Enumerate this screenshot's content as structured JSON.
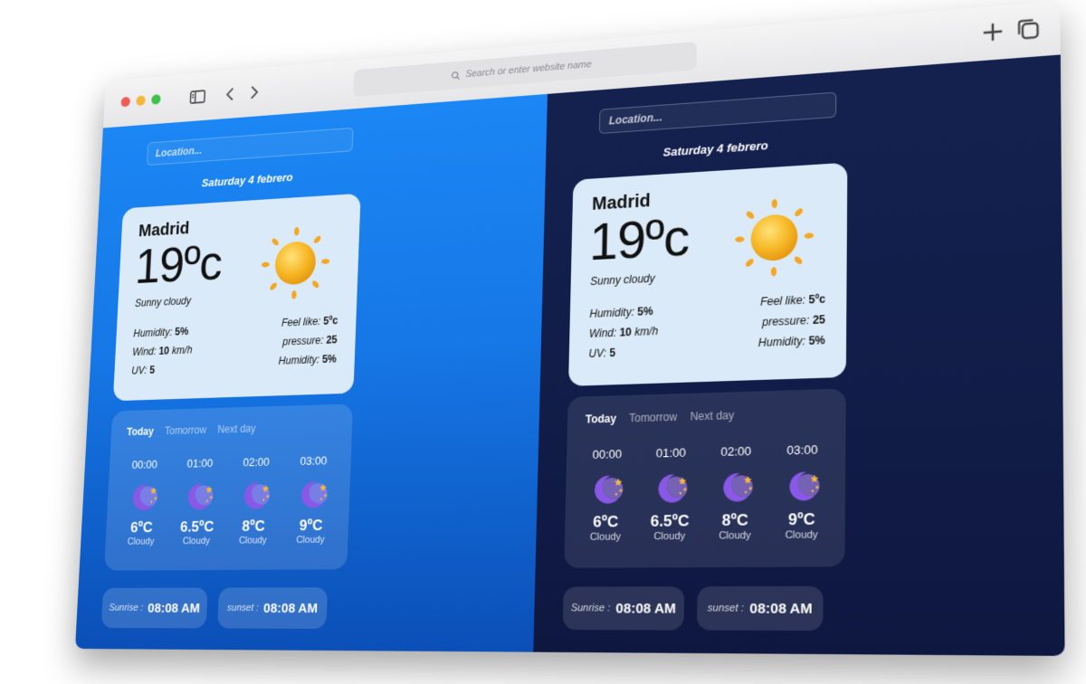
{
  "browser": {
    "address_placeholder": "Search or enter website name"
  },
  "panes": [
    {
      "theme": "light",
      "location_placeholder": "Location...",
      "date": "Saturday 4 febrero",
      "city": "Madrid",
      "temperature": "19ºc",
      "condition": "Sunny cloudy",
      "details_left": [
        {
          "label": "Humidity:",
          "value": "5%"
        },
        {
          "label": "Wind:",
          "value": "10",
          "unit": "km/h"
        },
        {
          "label": "UV:",
          "value": "5"
        }
      ],
      "details_right": [
        {
          "label": "Feel like:",
          "value": "5ºc"
        },
        {
          "label": "pressure:",
          "value": "25"
        },
        {
          "label": "Humidity:",
          "value": "5%"
        }
      ],
      "tabs": [
        "Today",
        "Tomorrow",
        "Next day"
      ],
      "active_tab": "Today",
      "hourly": [
        {
          "time": "00:00",
          "temp": "6ºC",
          "cond": "Cloudy",
          "icon": "moon-stars-icon"
        },
        {
          "time": "01:00",
          "temp": "6.5ºC",
          "cond": "Cloudy",
          "icon": "moon-stars-icon"
        },
        {
          "time": "02:00",
          "temp": "8ºC",
          "cond": "Cloudy",
          "icon": "moon-stars-icon"
        },
        {
          "time": "03:00",
          "temp": "9ºC",
          "cond": "Cloudy",
          "icon": "moon-stars-icon"
        }
      ],
      "sunrise_label": "Sunrise :",
      "sunrise": "08:08 AM",
      "sunset_label": "sunset :",
      "sunset": "08:08 AM"
    },
    {
      "theme": "dark",
      "location_placeholder": "Location...",
      "date": "Saturday 4 febrero",
      "city": "Madrid",
      "temperature": "19ºc",
      "condition": "Sunny cloudy",
      "details_left": [
        {
          "label": "Humidity:",
          "value": "5%"
        },
        {
          "label": "Wind:",
          "value": "10",
          "unit": "km/h"
        },
        {
          "label": "UV:",
          "value": "5"
        }
      ],
      "details_right": [
        {
          "label": "Feel like:",
          "value": "5ºc"
        },
        {
          "label": "pressure:",
          "value": "25"
        },
        {
          "label": "Humidity:",
          "value": "5%"
        }
      ],
      "tabs": [
        "Today",
        "Tomorrow",
        "Next day"
      ],
      "active_tab": "Today",
      "hourly": [
        {
          "time": "00:00",
          "temp": "6ºC",
          "cond": "Cloudy",
          "icon": "moon-stars-icon"
        },
        {
          "time": "01:00",
          "temp": "6.5ºC",
          "cond": "Cloudy",
          "icon": "moon-stars-icon"
        },
        {
          "time": "02:00",
          "temp": "8ºC",
          "cond": "Cloudy",
          "icon": "moon-stars-icon"
        },
        {
          "time": "03:00",
          "temp": "9ºC",
          "cond": "Cloudy",
          "icon": "moon-stars-icon"
        }
      ],
      "sunrise_label": "Sunrise :",
      "sunrise": "08:08 AM",
      "sunset_label": "sunset :",
      "sunset": "08:08 AM"
    }
  ],
  "colors": {
    "light_bg_top": "#1b87f4",
    "light_bg_bottom": "#0b4fb7",
    "dark_bg": "#111c47",
    "card_bg": "#dbeaf8",
    "sun": "#f7b928",
    "moon": "#8a58e6",
    "star": "#f4b73c"
  }
}
